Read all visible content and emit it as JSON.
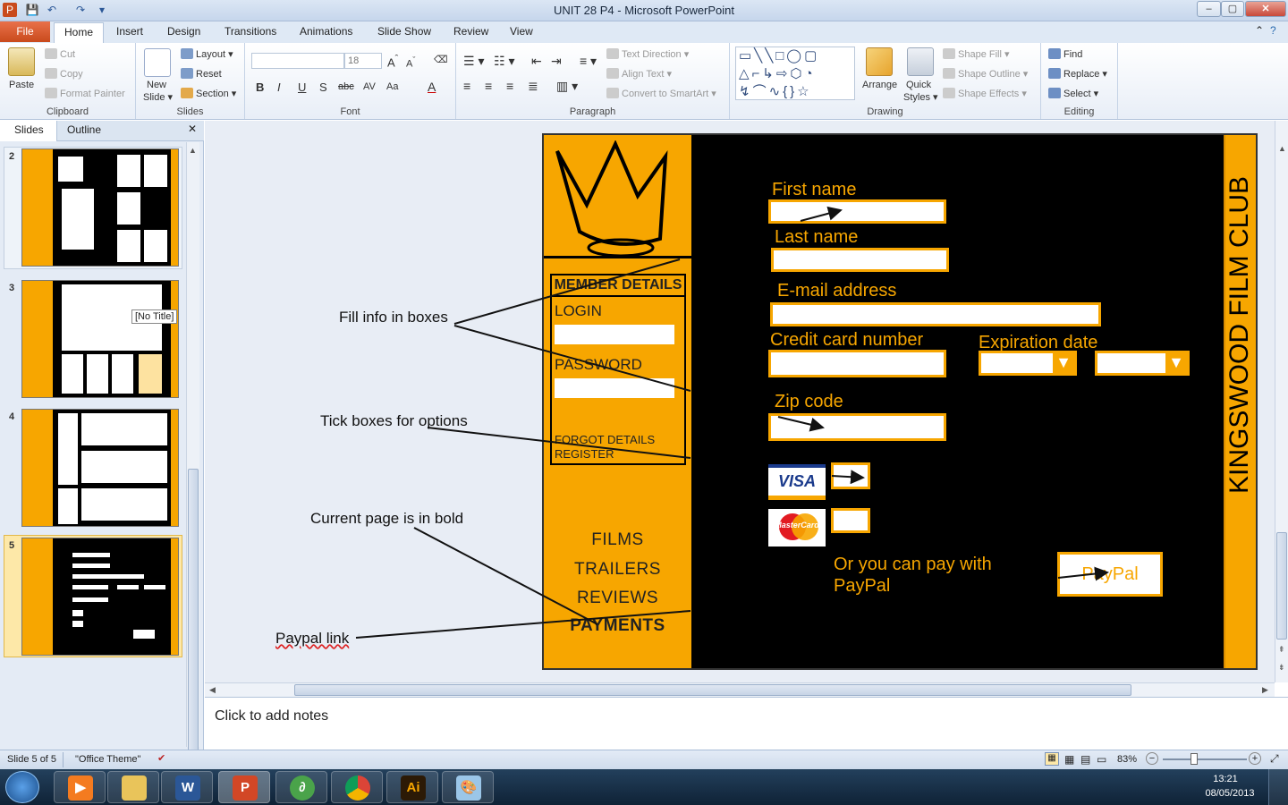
{
  "window": {
    "title": "UNIT 28 P4  -  Microsoft PowerPoint",
    "min": "–",
    "max": "▢",
    "close": "✕"
  },
  "tabs": {
    "file": "File",
    "home": "Home",
    "items": [
      "Insert",
      "Design",
      "Transitions",
      "Animations",
      "Slide Show",
      "Review",
      "View"
    ]
  },
  "ribbon": {
    "clipboard": {
      "label": "Clipboard",
      "paste": "Paste",
      "cut": "Cut",
      "copy": "Copy",
      "format_painter": "Format Painter"
    },
    "slides": {
      "label": "Slides",
      "new_slide": "New",
      "new_slide2": "Slide ▾",
      "layout": "Layout ▾",
      "reset": "Reset",
      "section": "Section ▾"
    },
    "font": {
      "label": "Font",
      "font_size": "18",
      "bold": "B",
      "italic": "I",
      "underline": "U",
      "shadow": "S",
      "strike": "abc",
      "spacing": "AV",
      "case": "Aa",
      "color": "A"
    },
    "paragraph": {
      "label": "Paragraph",
      "text_direction": "Text Direction ▾",
      "align_text": "Align Text ▾",
      "convert_smartart": "Convert to SmartArt ▾"
    },
    "drawing": {
      "label": "Drawing",
      "arrange": "Arrange",
      "quick_styles": "Quick",
      "quick_styles2": "Styles ▾",
      "shape_fill": "Shape Fill ▾",
      "shape_outline": "Shape Outline ▾",
      "shape_effects": "Shape Effects ▾"
    },
    "editing": {
      "label": "Editing",
      "find": "Find",
      "replace": "Replace ▾",
      "select": "Select ▾"
    }
  },
  "pane": {
    "tab_slides": "Slides",
    "tab_outline": "Outline",
    "slide_numbers": [
      "2",
      "3",
      "4",
      "5"
    ],
    "tooltip": "[No Title]"
  },
  "slide": {
    "member_details": "MEMBER DETAILS",
    "login": "LOGIN",
    "password": "PASSWORD",
    "forgot": "FORGOT DETAILS",
    "register": "REGISTER",
    "menu": [
      "FILMS",
      "TRAILERS",
      "REVIEWS",
      "PAYMENTS"
    ],
    "side_title": "KINGSWOOD FILM CLUB",
    "first_name": "First name",
    "last_name": "Last name",
    "email": "E-mail address",
    "credit_card": "Credit card number",
    "expiration": "Expiration date",
    "zip": "Zip code",
    "visa": "VISA",
    "mastercard": "MasterCard",
    "paypal_text_1": "Or you can pay with",
    "paypal_text_2": "PayPal",
    "paypal_button": "PayPal"
  },
  "annotations": {
    "fill_info": "Fill info in boxes",
    "tick_boxes": "Tick boxes for options",
    "current_page": "Current page is in bold",
    "paypal_link": "Paypal link"
  },
  "notes": {
    "placeholder": "Click to add notes"
  },
  "status": {
    "slide_of": "Slide 5 of 5",
    "theme": "\"Office Theme\"",
    "zoom": "83%"
  },
  "taskbar": {
    "time": "13:21",
    "date": "08/05/2013"
  },
  "colors": {
    "accent": "#f7a600",
    "slide_bg": "#000000"
  }
}
